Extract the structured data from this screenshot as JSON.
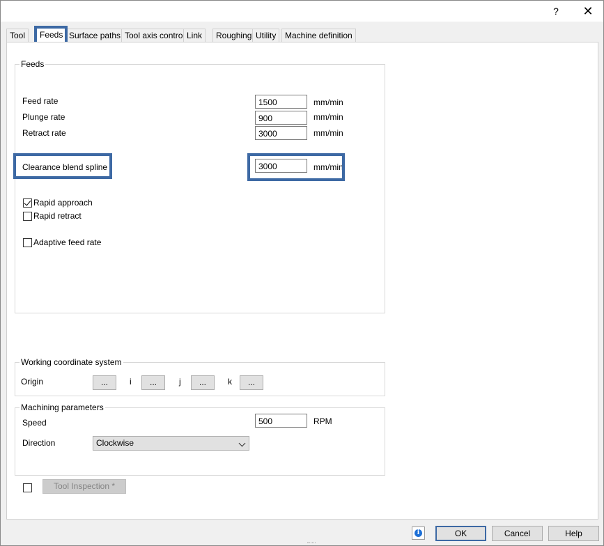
{
  "titlebar": {
    "help": "?",
    "close": "✕"
  },
  "tabs": [
    "Tool",
    "Feeds",
    "Surface paths",
    "Tool axis control",
    "Link",
    "Roughing",
    "Utility",
    "Machine definition"
  ],
  "feeds": {
    "group_title": "Feeds",
    "feed_rate": {
      "label": "Feed rate",
      "value": "1500",
      "unit": "mm/min"
    },
    "plunge_rate": {
      "label": "Plunge rate",
      "value": "900",
      "unit": "mm/min"
    },
    "retract_rate": {
      "label": "Retract rate",
      "value": "3000",
      "unit": "mm/min"
    },
    "clearance": {
      "label": "Clearance blend spline",
      "value": "3000",
      "unit": "mm/min"
    },
    "rapid_approach": {
      "label": "Rapid approach",
      "checked": true
    },
    "rapid_retract": {
      "label": "Rapid retract",
      "checked": false
    },
    "adaptive": {
      "label": "Adaptive feed rate",
      "checked": false
    }
  },
  "wcs": {
    "group_title": "Working coordinate system",
    "origin_label": "Origin",
    "i_label": "i",
    "j_label": "j",
    "k_label": "k",
    "dots": "..."
  },
  "machining": {
    "group_title": "Machining parameters",
    "speed_label": "Speed",
    "speed_value": "500",
    "speed_unit": "RPM",
    "direction_label": "Direction",
    "direction_value": "Clockwise"
  },
  "tool_inspection": {
    "label": "Tool Inspection *",
    "checked": false
  },
  "footer": {
    "ok": "OK",
    "cancel": "Cancel",
    "help": "Help",
    "info_icon": "info-icon",
    "info_glyph": "i"
  },
  "colors": {
    "highlight": "#3d69a4",
    "info": "#1c6fd6"
  }
}
